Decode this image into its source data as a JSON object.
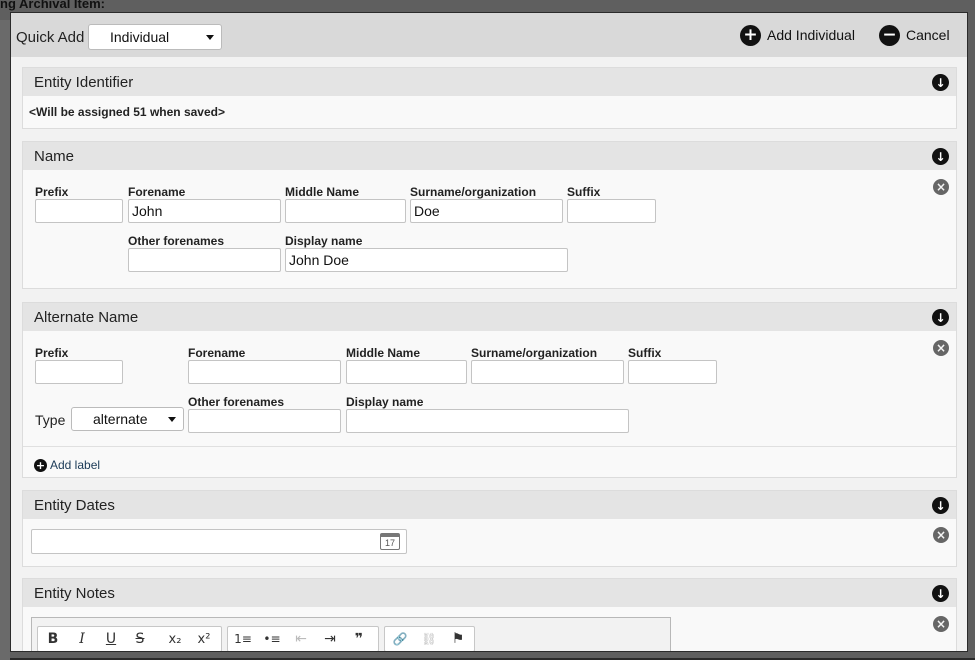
{
  "background": {
    "title": "ng Archival Item:"
  },
  "quick_add": {
    "label": "Quick Add",
    "type_value": "Individual",
    "add_button_label": "Add Individual",
    "cancel_button_label": "Cancel"
  },
  "icons": {
    "add": "+",
    "cancel": "−",
    "collapse": "↓",
    "remove": "×"
  },
  "entity_identifier": {
    "title": "Entity Identifier",
    "message": "<Will be assigned 51 when saved>"
  },
  "name": {
    "title": "Name",
    "labels": {
      "prefix": "Prefix",
      "forename": "Forename",
      "middle": "Middle Name",
      "surname": "Surname/organization",
      "suffix": "Suffix",
      "other_forenames": "Other forenames",
      "display_name": "Display name"
    },
    "values": {
      "prefix": "",
      "forename": "John",
      "middle": "",
      "surname": "Doe",
      "suffix": "",
      "other_forenames": "",
      "display_name": "John Doe"
    }
  },
  "alternate_name": {
    "title": "Alternate Name",
    "labels": {
      "prefix": "Prefix",
      "forename": "Forename",
      "middle": "Middle Name",
      "surname": "Surname/organization",
      "suffix": "Suffix",
      "other_forenames": "Other forenames",
      "display_name": "Display name",
      "type": "Type"
    },
    "values": {
      "prefix": "",
      "forename": "",
      "middle": "",
      "surname": "",
      "suffix": "",
      "other_forenames": "",
      "display_name": "",
      "type": "alternate"
    },
    "add_label": "Add label"
  },
  "entity_dates": {
    "title": "Entity Dates",
    "value": "",
    "calendar_day": "17"
  },
  "entity_notes": {
    "title": "Entity Notes",
    "toolbar": {
      "bold": "B",
      "italic": "I",
      "underline": "U",
      "strike": "S",
      "subscript": "x₂",
      "superscript": "x²",
      "numbered_list": "1≡",
      "bulleted_list": "•≡",
      "outdent": "⇤",
      "indent": "⇥",
      "blockquote": "❞",
      "link": "🔗",
      "unlink": "⛓",
      "anchor": "⚑"
    }
  }
}
